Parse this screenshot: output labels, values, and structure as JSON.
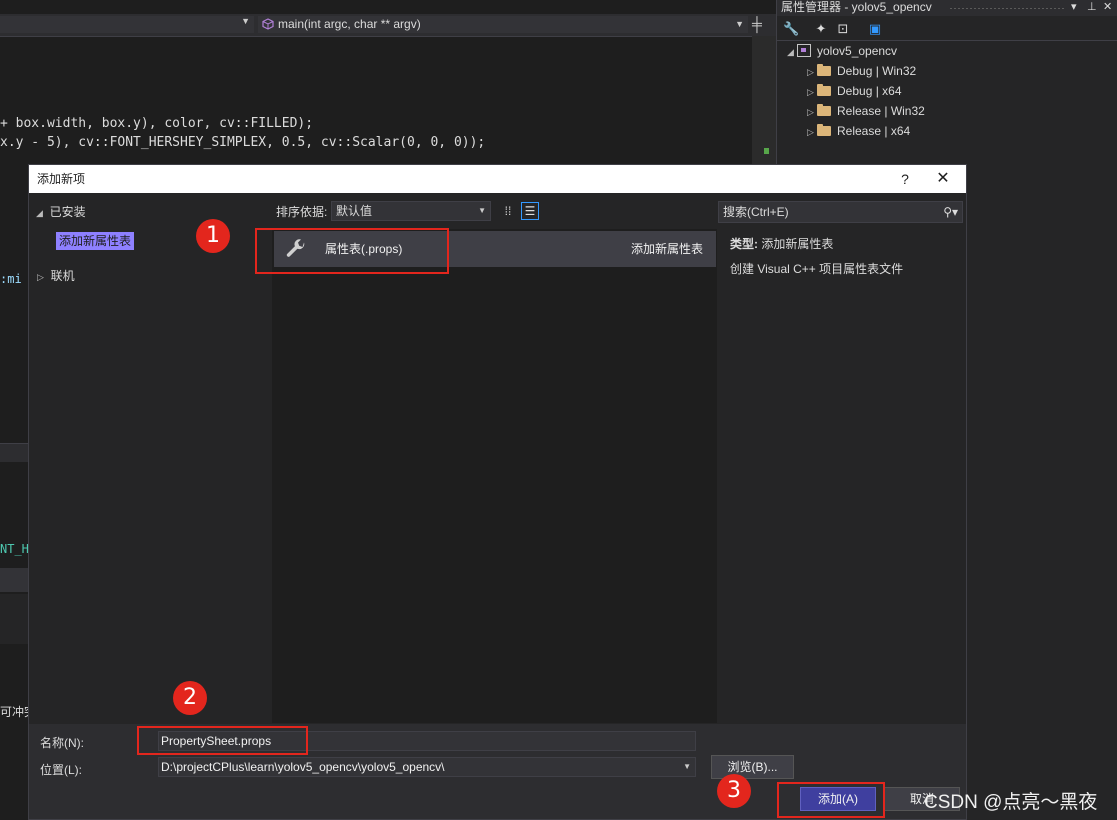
{
  "editor": {
    "function_nav": "main(int argc, char ** argv)",
    "code_line_1": {
      "p1": "+ box.width, box.y), color, cv::FILLED);"
    },
    "code_line_2": {
      "p1": "x.y - 5), cv::FONT_HERSHEY_SIMPLEX, 0.5, cv::Scalar(0, 0, 0));"
    },
    "edge_text_1": ":mi",
    "edge_text_2": "NT_H",
    "edge_text_3": "可冲突"
  },
  "property_manager": {
    "title": "属性管理器 - yolov5_opencv",
    "project": "yolov5_opencv",
    "configs": [
      "Debug | Win32",
      "Debug | x64",
      "Release | Win32",
      "Release | x64"
    ]
  },
  "dialog": {
    "title": "添加新项",
    "help": "?",
    "close": "✕",
    "categories": {
      "installed": "已安装",
      "selected": "添加新属性表",
      "online": "联机"
    },
    "sort_label": "排序依据:",
    "sort_value": "默认值",
    "search_placeholder": "搜索(Ctrl+E)",
    "template": {
      "name": "属性表(.props)",
      "description": "添加新属性表"
    },
    "info": {
      "type_label": "类型:",
      "type_value": "添加新属性表",
      "description": "创建 Visual C++ 项目属性表文件"
    },
    "name_label": "名称(N):",
    "name_value": "PropertySheet.props",
    "location_label": "位置(L):",
    "location_value": "D:\\projectCPlus\\learn\\yolov5_opencv\\yolov5_opencv\\",
    "browse_label": "浏览(B)...",
    "add_label": "添加(A)",
    "cancel_label": "取消"
  },
  "annotations": {
    "callouts": [
      "1",
      "2",
      "3"
    ],
    "color": "#e3261d"
  },
  "watermark": "CSDN @点亮～黑夜",
  "colors": {
    "accent": "#3f3f9f",
    "selected_category": "#8e80ff",
    "background": "#1e1e1e"
  }
}
